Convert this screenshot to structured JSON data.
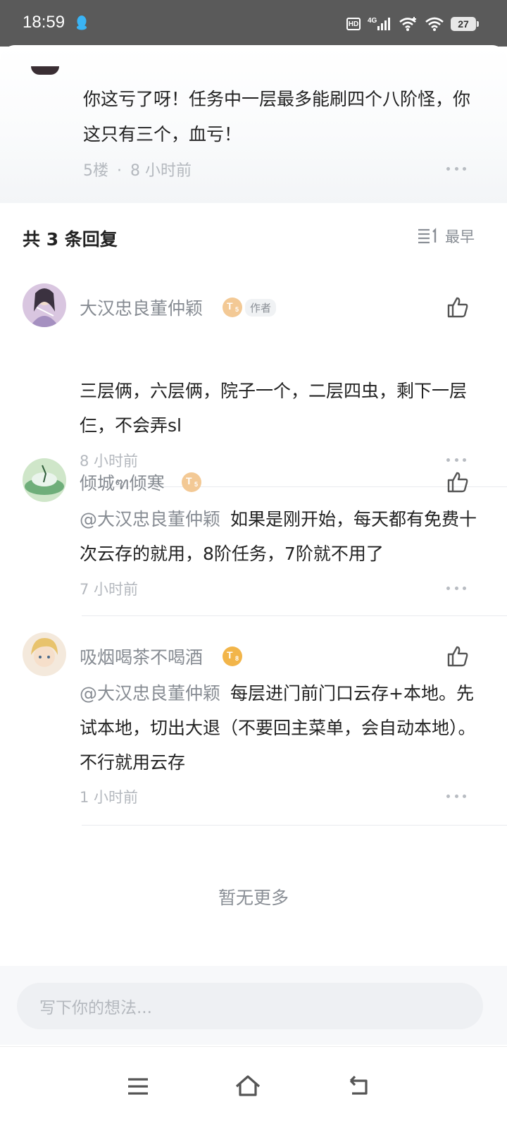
{
  "status_bar": {
    "time": "18:59",
    "hd_label": "HD",
    "network": "4G",
    "battery": "27"
  },
  "parent_comment": {
    "text": "你这亏了呀！任务中一层最多能刷四个八阶怪，你这只有三个，血亏！",
    "floor": "5楼",
    "separator": "·",
    "time": "8 小时前"
  },
  "replies_header": {
    "title": "共 3 条回复",
    "sort_label": "最早"
  },
  "replies": [
    {
      "username": "大汉忠良董仲颖",
      "level": "5",
      "author_tag": "作者",
      "mention": "",
      "text": "三层俩，六层俩，院子一个，二层四虫，剩下一层仨，不会弄sl",
      "time": "8 小时前"
    },
    {
      "username": "倾城ฑ倾寒",
      "level": "5",
      "mention": "@大汉忠良董仲颖",
      "text": "如果是刚开始，每天都有免费十次云存的就用，8阶任务，7阶就不用了",
      "time": "7 小时前"
    },
    {
      "username": "吸烟喝茶不喝酒",
      "level": "8",
      "mention": "@大汉忠良董仲颖",
      "text": "每层进门前门口云存+本地。先试本地，切出大退（不要回主菜单，会自动本地）。不行就用云存",
      "time": "1 小时前"
    }
  ],
  "no_more_text": "暂无更多",
  "input": {
    "placeholder": "写下你的想法..."
  },
  "colors": {
    "badge_gold": "#f2b54a",
    "badge_light": "#f3c995",
    "status_bar": "#5a5a5a"
  }
}
